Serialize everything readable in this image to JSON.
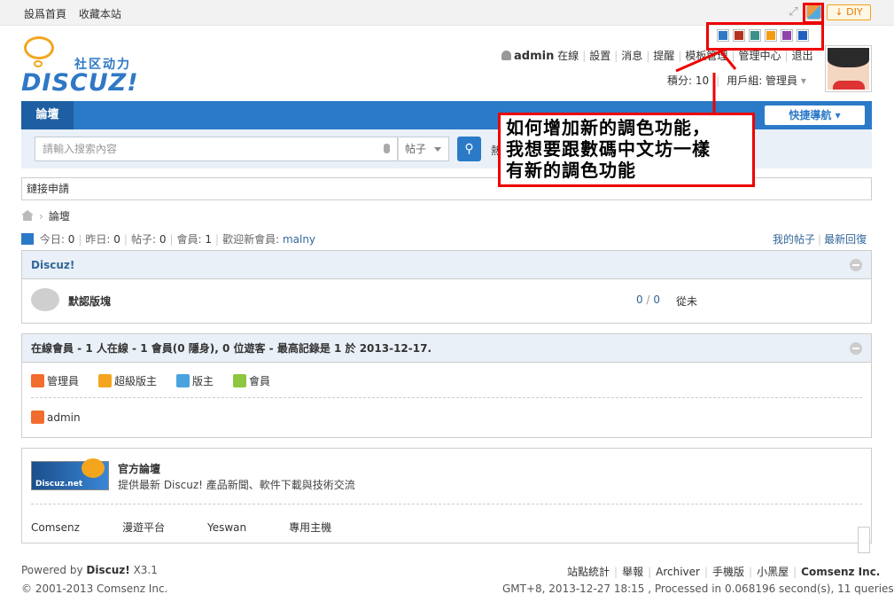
{
  "topbar": {
    "set_home": "設爲首頁",
    "bookmark": "收藏本站",
    "diy_label": "DIY"
  },
  "header": {
    "logo_tag": "社区动力",
    "logo_word": "DISCUZ!",
    "username": "admin",
    "online_status": "在線",
    "menu": [
      "設置",
      "消息",
      "提醒",
      "模板管理",
      "管理中心",
      "退出"
    ],
    "credits": "積分: 10",
    "usergroup": "用戶組: 管理員"
  },
  "palette_colors": [
    "#2f78c5",
    "#b5321e",
    "#3a8f8a",
    "#f39c12",
    "#8e44ad",
    "#1f5fbf"
  ],
  "nav": {
    "tab_label": "論壇",
    "quick_nav": "快捷導航 ▾"
  },
  "search": {
    "placeholder": "請輸入搜索內容",
    "type": "帖子",
    "hot_prefix": "熱"
  },
  "link_strip": "鏈接申請",
  "breadcrumb": {
    "current": "論壇"
  },
  "stats": {
    "today_label": "今日:",
    "today": "0",
    "yesterday_label": "昨日:",
    "yesterday": "0",
    "posts_label": "帖子:",
    "posts": "0",
    "members_label": "會員:",
    "members": "1",
    "welcome_label": "歡迎新會員:",
    "new_member": "malny",
    "my_posts": "我的帖子",
    "latest_reply": "最新回復"
  },
  "forum_group": {
    "title": "Discuz!",
    "forum_name": "默認版塊",
    "threads": "0",
    "posts": "0",
    "last": "從未"
  },
  "online": {
    "title": "在線會員 - 1 人在線 - 1 會員(0 隱身), 0 位遊客 - 最高記錄是 1 於 2013-12-17.",
    "legend": [
      {
        "label": "管理員",
        "color": "#f26c2e"
      },
      {
        "label": "超級版主",
        "color": "#f3a61d"
      },
      {
        "label": "版主",
        "color": "#4aa3df"
      },
      {
        "label": "會員",
        "color": "#8dc63f"
      }
    ],
    "users": [
      "admin"
    ]
  },
  "official": {
    "logo_text": "Discuz.net",
    "title": "官方論壇",
    "desc": "提供最新 Discuz! 產品新聞、軟件下載與技術交流",
    "links": [
      "Comsenz",
      "漫遊平台",
      "Yeswan",
      "專用主機"
    ]
  },
  "footer": {
    "powered_by": "Powered by",
    "product": "Discuz!",
    "version": "X3.1",
    "copyright": "© 2001-2013 Comsenz Inc.",
    "links": [
      "站點統計",
      "舉報",
      "Archiver",
      "手機版",
      "小黑屋"
    ],
    "company": "Comsenz Inc.",
    "info": "GMT+8, 2013-12-27 18:15 , Processed in 0.068196 second(s), 11 queries ."
  },
  "annotation": {
    "lines": [
      "如何增加新的調色功能，",
      "我想要跟數碼中文坊一樣",
      "有新的調色功能"
    ],
    "color": "#e00000"
  }
}
